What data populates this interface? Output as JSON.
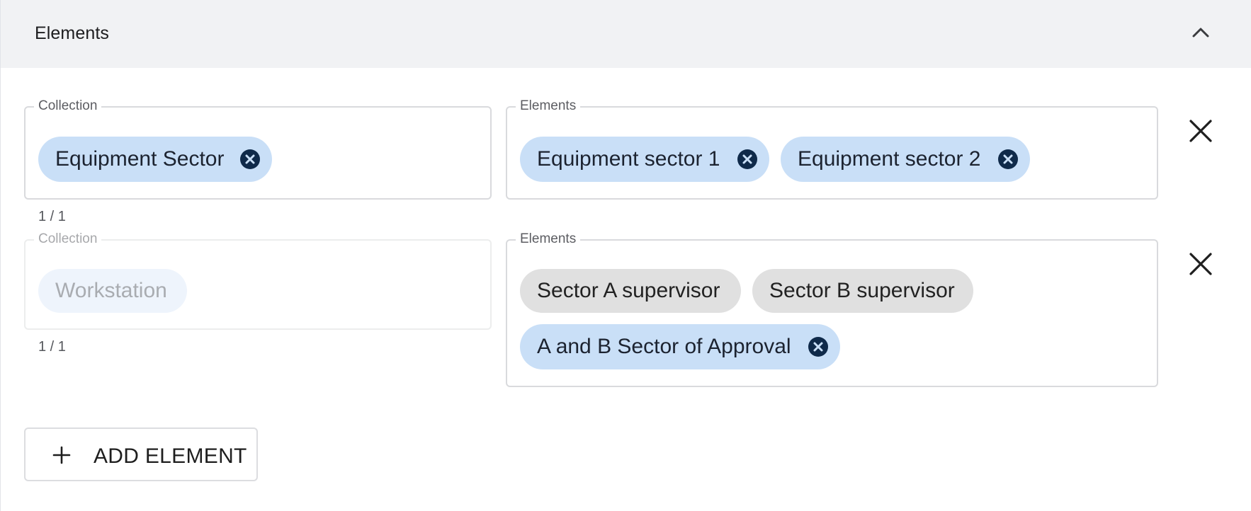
{
  "section": {
    "title": "Elements",
    "toggle_icon": "chevron-up-icon"
  },
  "rows": [
    {
      "collection": {
        "label": "Collection",
        "chips": [
          "Equipment Sector"
        ],
        "counter": "1 / 1",
        "disabled": false
      },
      "elements": {
        "label": "Elements",
        "chips": [
          "Equipment sector 1",
          "Equipment sector 2"
        ]
      }
    },
    {
      "collection": {
        "label": "Collection",
        "chips": [
          "Workstation"
        ],
        "counter": "1 / 1",
        "disabled": true
      },
      "elements": {
        "label": "Elements",
        "chips": [
          "Sector A supervisor",
          "Sector B supervisor",
          "A and B Sector of Approval"
        ],
        "chip_states": [
          "locked",
          "locked",
          "removable"
        ]
      }
    }
  ],
  "add_button": {
    "label": "ADD ELEMENT",
    "icon": "plus-icon"
  },
  "colors": {
    "chip_selected": "#c9dff7",
    "chip_locked": "#e0e0e0",
    "chip_remove_icon": "#0f2a4a",
    "header_bg": "#f1f2f4"
  }
}
